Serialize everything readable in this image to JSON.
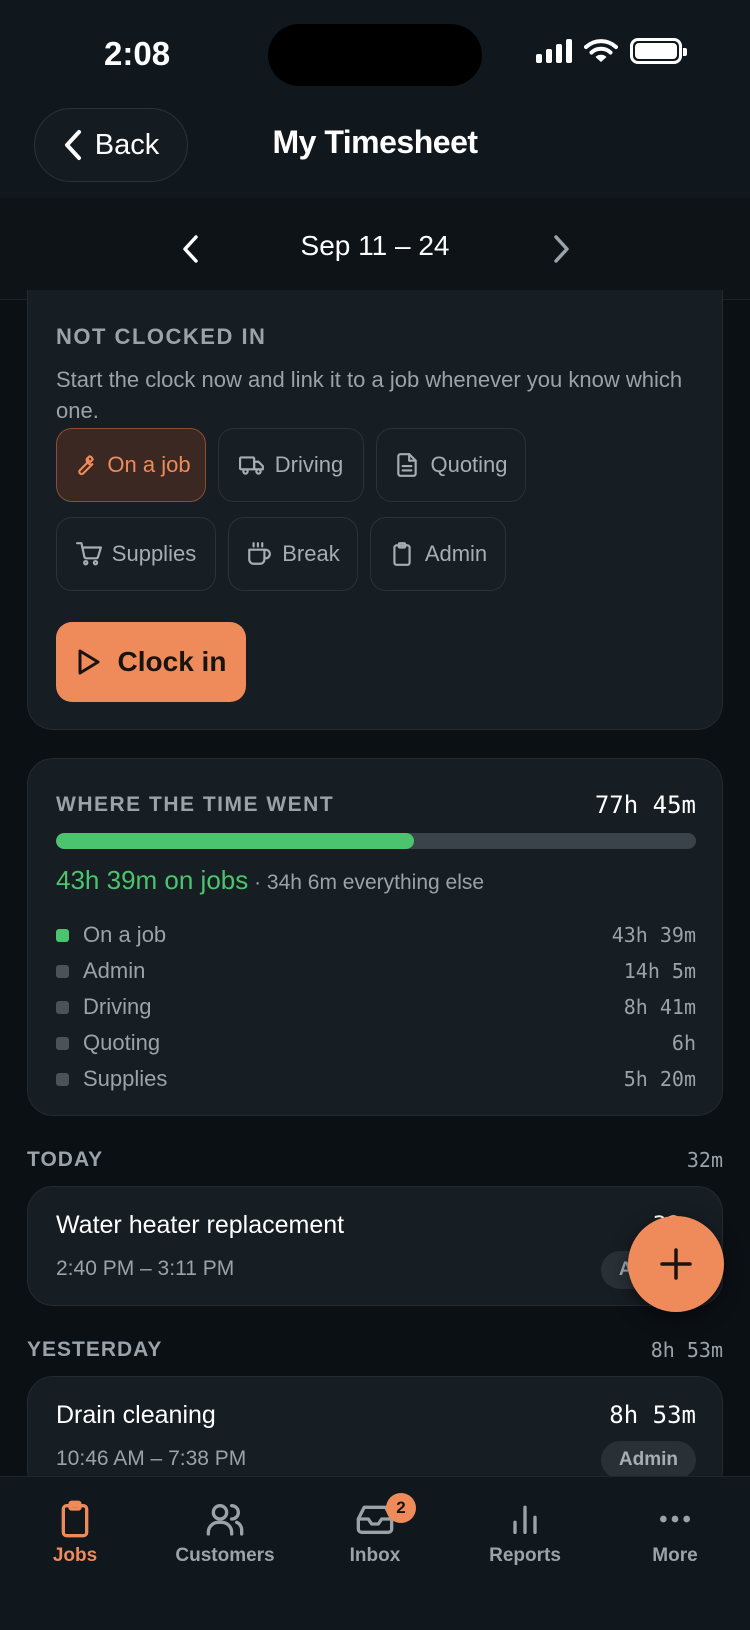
{
  "status_bar": {
    "time": "2:08"
  },
  "header": {
    "back_label": "Back",
    "title": "My Timesheet"
  },
  "date_nav": {
    "range": "Sep 11 – 24"
  },
  "clock": {
    "heading": "NOT CLOCKED IN",
    "description": "Start the clock now and link it to a job whenever you know which one.",
    "chips": [
      {
        "label": "On a job",
        "icon": "wrench-icon",
        "active": true
      },
      {
        "label": "Driving",
        "icon": "truck-icon",
        "active": false
      },
      {
        "label": "Quoting",
        "icon": "document-icon",
        "active": false
      },
      {
        "label": "Supplies",
        "icon": "cart-icon",
        "active": false
      },
      {
        "label": "Break",
        "icon": "coffee-icon",
        "active": false
      },
      {
        "label": "Admin",
        "icon": "clipboard-icon",
        "active": false
      }
    ],
    "button_label": "Clock in"
  },
  "time_breakdown": {
    "heading": "WHERE THE TIME WENT",
    "total": "77h 45m",
    "jobs_fraction": 0.56,
    "summary_jobs": "43h 39m on jobs",
    "summary_rest": " · 34h 6m everything else",
    "items": [
      {
        "label": "On a job",
        "value": "43h 39m",
        "color": "#4cc46d"
      },
      {
        "label": "Admin",
        "value": "14h 5m",
        "color": "#4b5359"
      },
      {
        "label": "Driving",
        "value": "8h 41m",
        "color": "#4b5359"
      },
      {
        "label": "Quoting",
        "value": "6h",
        "color": "#4b5359"
      },
      {
        "label": "Supplies",
        "value": "5h 20m",
        "color": "#4b5359"
      }
    ]
  },
  "today": {
    "title": "TODAY",
    "total": "32m",
    "entry": {
      "title": "Water heater replacement",
      "time": "2:40 PM – 3:11 PM",
      "duration": "32m",
      "tag": "Admin"
    }
  },
  "yesterday": {
    "title": "YESTERDAY",
    "total": "8h 53m",
    "entry": {
      "title": "Drain cleaning",
      "time": "10:46 AM – 7:38 PM",
      "duration": "8h 53m",
      "tag": "Admin"
    }
  },
  "tabs": [
    {
      "label": "Jobs",
      "icon": "clipboard-icon",
      "active": true
    },
    {
      "label": "Customers",
      "icon": "users-icon",
      "active": false
    },
    {
      "label": "Inbox",
      "icon": "inbox-icon",
      "active": false,
      "badge": "2"
    },
    {
      "label": "Reports",
      "icon": "bar-chart-icon",
      "active": false
    },
    {
      "label": "More",
      "icon": "more-icon",
      "active": false
    }
  ],
  "colors": {
    "accent": "#ef8a5b",
    "green": "#4cc46d",
    "background": "#0b1015",
    "card": "#161d23"
  }
}
